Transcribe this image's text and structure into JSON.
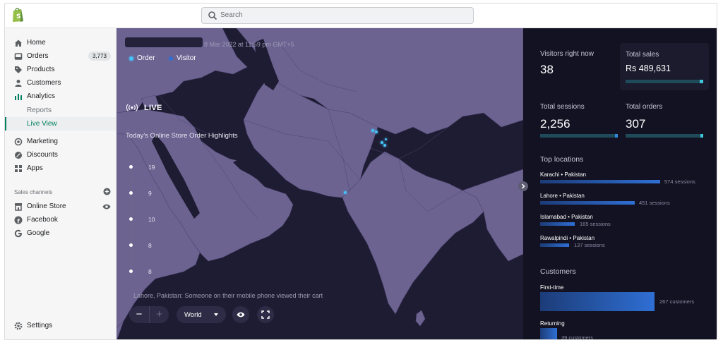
{
  "search": {
    "placeholder": "Search"
  },
  "sidebar": {
    "items": [
      {
        "label": "Home"
      },
      {
        "label": "Orders",
        "badge": "3,773"
      },
      {
        "label": "Products"
      },
      {
        "label": "Customers"
      },
      {
        "label": "Analytics"
      },
      {
        "label": "Reports"
      },
      {
        "label": "Live View"
      },
      {
        "label": "Marketing"
      },
      {
        "label": "Discounts"
      },
      {
        "label": "Apps"
      }
    ],
    "sales_channels_title": "Sales channels",
    "channels": [
      {
        "label": "Online Store"
      },
      {
        "label": "Facebook"
      },
      {
        "label": "Google"
      }
    ],
    "settings": "Settings"
  },
  "map": {
    "date": "8 Mar 2022 at 11:59 pm GMT+5",
    "legend_order": "Order",
    "legend_visitor": "Visitor",
    "live": "LIVE",
    "highlights_title": "Today's Online Store Order Highlights",
    "highlights": [
      "19",
      "9",
      "10",
      "8",
      "8"
    ],
    "activity": "Lahore, Pakistan: Someone on their mobile phone viewed their cart",
    "zoom_out": "−",
    "zoom_in": "+",
    "region": "World"
  },
  "metrics": {
    "visitors_label": "Visitors right now",
    "visitors_value": "38",
    "sales_label": "Total sales",
    "sales_value": "Rs 489,631",
    "sessions_label": "Total sessions",
    "sessions_value": "2,256",
    "orders_label": "Total orders",
    "orders_value": "307"
  },
  "top_locations": {
    "title": "Top locations",
    "items": [
      {
        "name": "Karachi • Pakistan",
        "sessions": "574 sessions",
        "value": 574
      },
      {
        "name": "Lahore • Pakistan",
        "sessions": "451 sessions",
        "value": 451
      },
      {
        "name": "Islamabad • Pakistan",
        "sessions": "165 sessions",
        "value": 165
      },
      {
        "name": "Rawalpindi • Pakistan",
        "sessions": "137 sessions",
        "value": 137
      }
    ]
  },
  "customers": {
    "title": "Customers",
    "first_time_label": "First-time",
    "first_time_value": "267 customers",
    "returning_label": "Returning",
    "returning_value": "39 customers"
  },
  "colors": {
    "accent": "#008060",
    "map_bg": "#1e1c33",
    "land": "#6c6391",
    "marker": "#47c1f7",
    "panel_bg": "#131222"
  }
}
